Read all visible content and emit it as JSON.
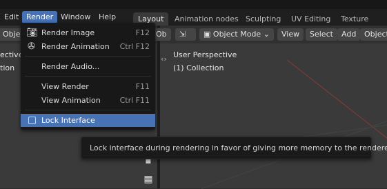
{
  "menubar": {
    "items": [
      {
        "label": "Edit"
      },
      {
        "label": "Render"
      },
      {
        "label": "Window"
      },
      {
        "label": "Help"
      }
    ]
  },
  "workspace_tabs": [
    {
      "label": "Layout"
    },
    {
      "label": "Animation nodes"
    },
    {
      "label": "Sculpting"
    },
    {
      "label": "UV Editing"
    },
    {
      "label": "Texture Paint"
    }
  ],
  "left_view": {
    "header_button": "Obje",
    "text_line1": "ective",
    "text_line2": "tion"
  },
  "viewport": {
    "header_left_button": "Ob",
    "mode_label": "Object Mode",
    "view_label": "View",
    "select_label": "Select",
    "add_label": "Add",
    "object_label": "Object",
    "perspective": "User Perspective",
    "collection": "(1) Collection"
  },
  "render_menu": {
    "items": [
      {
        "label": "Render Image",
        "shortcut": "F12",
        "icon": "camera-icon"
      },
      {
        "label": "Render Animation",
        "shortcut": "Ctrl F12",
        "icon": "film-reel-icon"
      },
      {
        "label": "Render Audio...",
        "shortcut": ""
      },
      {
        "label": "View Render",
        "shortcut": "F11"
      },
      {
        "label": "View Animation",
        "shortcut": "Ctrl F11"
      },
      {
        "label": "Lock Interface",
        "shortcut": "",
        "checked": false
      }
    ]
  },
  "tooltip": {
    "text": "Lock interface during rendering in favor of giving more memory to the renderer."
  },
  "colors": {
    "accent": "#4772b3",
    "menu_bg": "#181818",
    "viewport_bg": "#3a3a3a"
  }
}
